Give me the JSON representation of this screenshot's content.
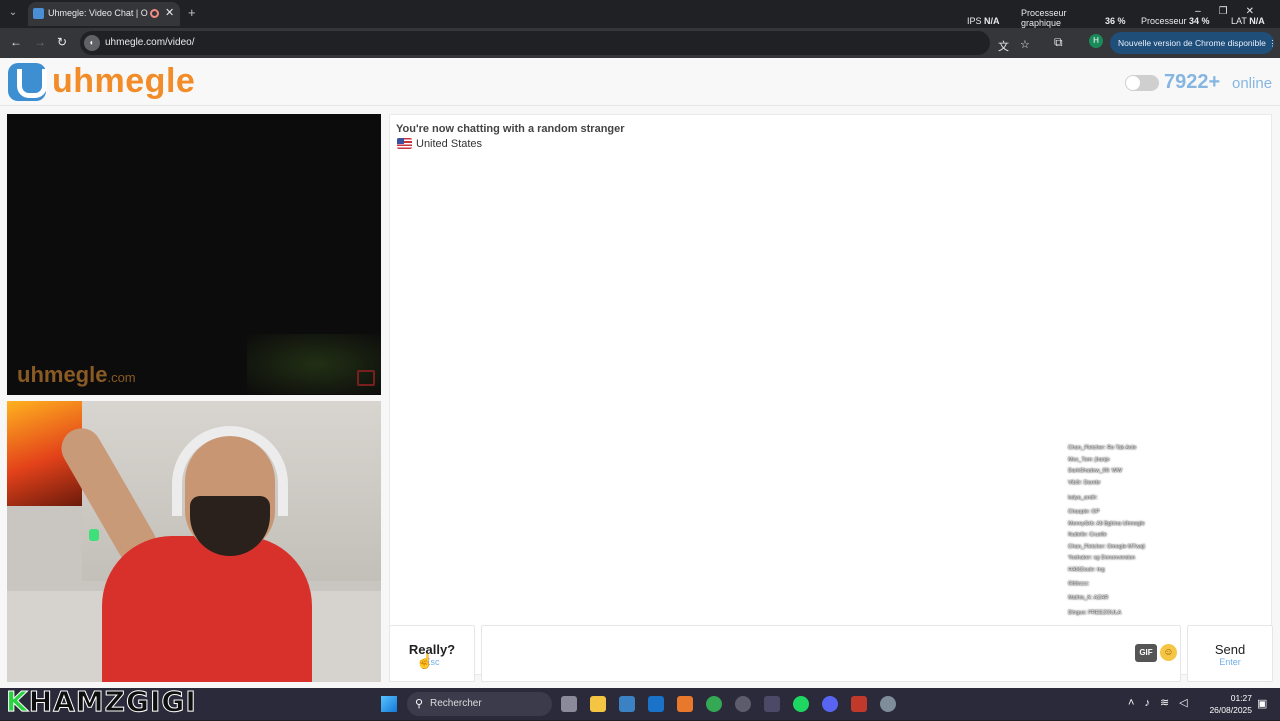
{
  "browser": {
    "tab_title": "Uhmegle: Video Chat | Ome",
    "url": "uhmegle.com/video/",
    "update_label": "Nouvelle version de Chrome disponible",
    "profile_initial": "H"
  },
  "system_stats": {
    "ips_label": "IPS",
    "ips_value": "N/A",
    "gpu_label_1": "Processeur",
    "gpu_label_2": "graphique",
    "gpu_value": "36 %",
    "cpu_label": "Processeur",
    "cpu_value": "34 %",
    "lat_label": "LAT",
    "lat_value": "N/A"
  },
  "site": {
    "logo_text": "uhmegle",
    "online_count": "7922+",
    "online_label": "online",
    "watermark_main": "uhmegle",
    "watermark_suffix": ".com"
  },
  "chat": {
    "status": "You're now chatting with a random stranger",
    "country": "United States"
  },
  "stream_chat_lines": [
    "Chan_Fletcher: Ro Tak Anle",
    "Mox_Tom: jhanjo",
    "DarkShadow_99: WW",
    "Vib3r: Darebr",
    "kalya_andir:",
    "Chaaple: OP",
    "MoneyGrb: Ali Bghina Uhmegle",
    "Nutielle: Cruelle",
    "Chan_Fletcher: Omegle M7waji",
    "Yoshaker: sg Dononversion",
    "HAMZoule: tng",
    "Gibbzzz:",
    "Mathis_K: AZAR",
    "Dingus: FREEZOULA"
  ],
  "controls": {
    "esc_label": "Really?",
    "esc_hint": "Esc",
    "gif_label": "GIF",
    "send_label": "Send",
    "send_hint": "Enter"
  },
  "taskbar": {
    "streamer_first": "K",
    "streamer_rest": "HAMZGIGI",
    "search_placeholder": "Rechercher",
    "time": "01:27",
    "date": "26/08/2025"
  },
  "colors": {
    "accent_logo": "#f28c28",
    "brand_blue": "#3d8fd1",
    "online_blue": "#86b6e0",
    "hint_blue": "#6fb0ea"
  }
}
